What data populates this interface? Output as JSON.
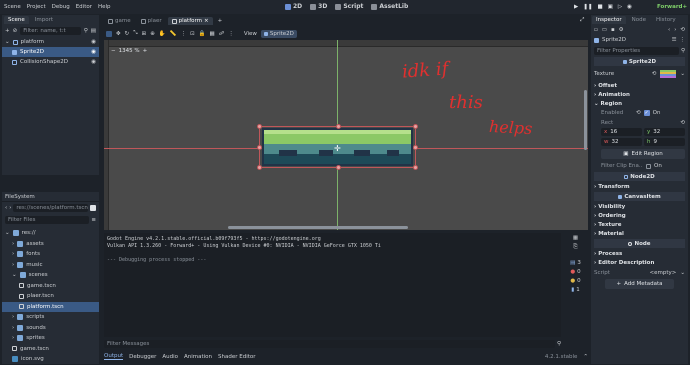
{
  "menu": {
    "items": [
      "Scene",
      "Project",
      "Debug",
      "Editor",
      "Help"
    ]
  },
  "workspaces": {
    "d2": "2D",
    "d3": "3D",
    "script": "Script",
    "assetlib": "AssetLib"
  },
  "renderer": "Forward+",
  "scene_dock": {
    "tabs": [
      "Scene",
      "Import"
    ],
    "filter_placeholder": "Filter: name, t:t",
    "nodes": [
      "platform",
      "Sprite2D",
      "CollisionShape2D"
    ]
  },
  "filesystem": {
    "title": "FileSystem",
    "path": "res://scenes/platform.tscn",
    "filter_placeholder": "Filter Files",
    "items": [
      {
        "label": "res://",
        "depth": 0,
        "type": "folder"
      },
      {
        "label": "assets",
        "depth": 1,
        "type": "folder"
      },
      {
        "label": "fonts",
        "depth": 1,
        "type": "folder"
      },
      {
        "label": "music",
        "depth": 1,
        "type": "folder"
      },
      {
        "label": "scenes",
        "depth": 1,
        "type": "folder"
      },
      {
        "label": "game.tscn",
        "depth": 2,
        "type": "scene"
      },
      {
        "label": "plaer.tscn",
        "depth": 2,
        "type": "scene"
      },
      {
        "label": "platform.tscn",
        "depth": 2,
        "type": "scene"
      },
      {
        "label": "scripts",
        "depth": 1,
        "type": "folder"
      },
      {
        "label": "sounds",
        "depth": 1,
        "type": "folder"
      },
      {
        "label": "sprites",
        "depth": 1,
        "type": "folder"
      },
      {
        "label": "game.tscn",
        "depth": 1,
        "type": "scene"
      },
      {
        "label": "icon.svg",
        "depth": 1,
        "type": "image"
      }
    ]
  },
  "editor_tabs": [
    "game",
    "plaer",
    "platform"
  ],
  "viewport": {
    "zoom": "1345 %",
    "view_label": "View",
    "node_label": "Sprite2D",
    "annotation": [
      "idk if",
      "this",
      "helps"
    ]
  },
  "output": {
    "lines": [
      "Godot Engine v4.2.1.stable.official.b09f793f5 - https://godotengine.org",
      "Vulkan API 1.3.260 - Forward+ - Using Vulkan Device #0: NVIDIA - NVIDIA GeForce GTX 1050 Ti",
      "",
      "--- Debugging process stopped ---"
    ],
    "filter_placeholder": "Filter Messages",
    "counts": [
      "3",
      "0",
      "0",
      "1"
    ],
    "bottom_tabs": [
      "Output",
      "Debugger",
      "Audio",
      "Animation",
      "Shader Editor"
    ],
    "version": "4.2.1.stable"
  },
  "inspector": {
    "tabs": [
      "Inspector",
      "Node",
      "History"
    ],
    "node": "Sprite2D",
    "filter_placeholder": "Filter Properties",
    "class_sprite": "Sprite2D",
    "texture_label": "Texture",
    "sections_top": [
      "Offset",
      "Animation",
      "Region"
    ],
    "enabled_label": "Enabled",
    "enabled_value": "On",
    "rect_label": "Rect",
    "rect": {
      "x": "16",
      "y": "32",
      "w": "32",
      "h": "9"
    },
    "edit_region": "Edit Region",
    "filter_clip": "Filter Clip Ena...",
    "filter_clip_value": "On",
    "class_node2d": "Node2D",
    "transform": "Transform",
    "class_canvas": "CanvasItem",
    "canvas_sections": [
      "Visibility",
      "Ordering",
      "Texture",
      "Material"
    ],
    "class_node": "Node",
    "node_sections": [
      "Process",
      "Editor Description"
    ],
    "script_label": "Script",
    "script_value": "<empty>",
    "add_metadata": "Add Metadata"
  }
}
